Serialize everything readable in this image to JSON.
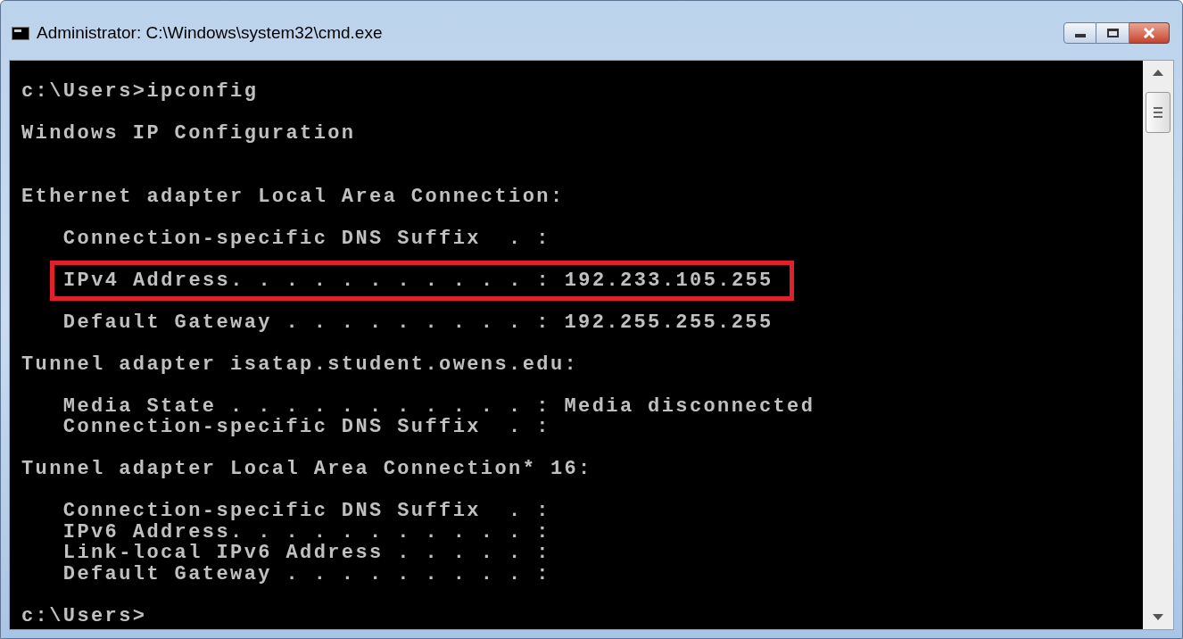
{
  "window": {
    "title": "Administrator: C:\\Windows\\system32\\cmd.exe"
  },
  "console": {
    "lines": [
      {
        "kind": "text",
        "text": "c:\\Users>ipconfig"
      },
      {
        "kind": "blank"
      },
      {
        "kind": "text",
        "text": "Windows IP Configuration"
      },
      {
        "kind": "blank"
      },
      {
        "kind": "blank"
      },
      {
        "kind": "text",
        "text": "Ethernet adapter Local Area Connection:"
      },
      {
        "kind": "blank"
      },
      {
        "kind": "text",
        "text": "   Connection-specific DNS Suffix  . :"
      },
      {
        "kind": "blank"
      },
      {
        "kind": "highlighted",
        "text": "IPv4 Address. . . . . . . . . . . : 192.233.105.255"
      },
      {
        "kind": "blank"
      },
      {
        "kind": "text",
        "text": "   Default Gateway . . . . . . . . . : 192.255.255.255"
      },
      {
        "kind": "blank"
      },
      {
        "kind": "text",
        "text": "Tunnel adapter isatap.student.owens.edu:"
      },
      {
        "kind": "blank"
      },
      {
        "kind": "text",
        "text": "   Media State . . . . . . . . . . . : Media disconnected"
      },
      {
        "kind": "text",
        "text": "   Connection-specific DNS Suffix  . :"
      },
      {
        "kind": "blank"
      },
      {
        "kind": "text",
        "text": "Tunnel adapter Local Area Connection* 16:"
      },
      {
        "kind": "blank"
      },
      {
        "kind": "text",
        "text": "   Connection-specific DNS Suffix  . :"
      },
      {
        "kind": "text",
        "text": "   IPv6 Address. . . . . . . . . . . :"
      },
      {
        "kind": "text",
        "text": "   Link-local IPv6 Address . . . . . :"
      },
      {
        "kind": "text",
        "text": "   Default Gateway . . . . . . . . . :"
      },
      {
        "kind": "blank"
      },
      {
        "kind": "text",
        "text": "c:\\Users>"
      }
    ]
  }
}
